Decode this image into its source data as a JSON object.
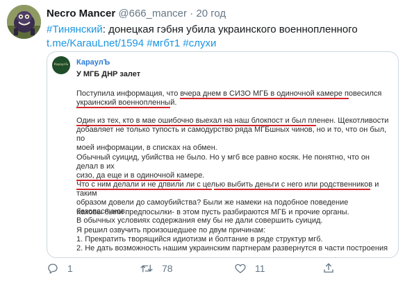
{
  "tweet": {
    "display_name": "Necro Mancer",
    "handle": "@666_mancer",
    "separator": "·",
    "time": "20 год",
    "hashtag_lead": "#Тинянский",
    "body_text": ": донецкая гэбня убила украинского военнопленного",
    "link": "t.me/KarauLnet/1594",
    "tags": [
      "#мгбт1",
      "#слухи"
    ]
  },
  "card": {
    "logo_text": "КараулЪ",
    "channel": "КараулЪ",
    "title": "У МГБ ДНР залет",
    "paragraphs": [
      [
        "Поступила информация, что вчера днем в СИЗО МГБ в одиночной камере повесился",
        "украинский военнопленный."
      ],
      [
        "Один из тех, кто в мае ошибочно выехал на наш блокпост и был пленен. Щекотливости",
        "добавляет не только тупость и самодурство ряда МГБшных чинов, но и то, что он был, по",
        "моей информации, в списках на обмен."
      ],
      [
        "Обычный суицид, убийства не было. Но у мгб все равно косяк. Не понятно, что он делал в их",
        "сизо, да еще и в одиночной камере.",
        "Что с ним делали и не дпвили ли с целью выбить деньги с него или родственников и таким",
        "образом довели до самоубийства? Были же намеки на подобное поведение безопасников.",
        "В обычных условиях содержания ему бы не дали совершить суицид."
      ],
      [
        "Каковы были предпосылки- в этом пусть разбираются МГБ и прочие органы."
      ],
      [
        "Я решил озвучить произошедшее по двум причинам:",
        "1. Прекратить творящийся идиотизм и болтание в ряде структур мгб.",
        "2. Не дать возможность нашим украинским партнерам развернутся в части построения"
      ]
    ]
  },
  "actions": {
    "replies": "1",
    "retweets": "78",
    "likes": "11"
  },
  "colors": {
    "link": "#1b95e0",
    "underline": "#d2262b",
    "muted": "#657786"
  }
}
